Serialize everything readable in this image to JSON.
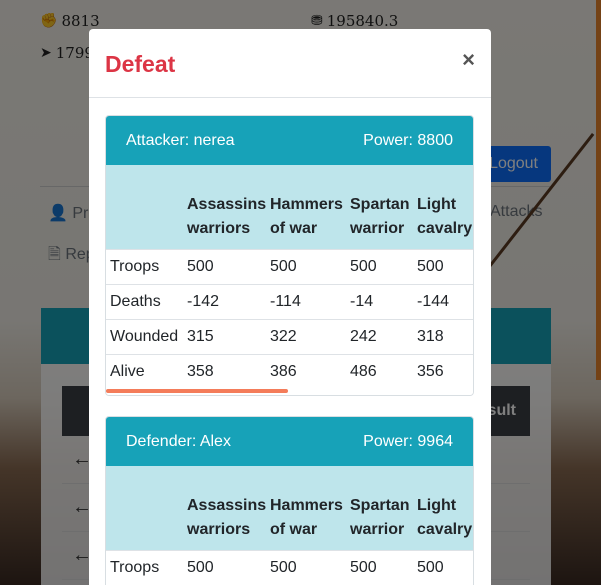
{
  "background": {
    "stats": [
      {
        "icon": "fist-icon",
        "glyph": "✊",
        "value": "8813"
      },
      {
        "icon": "coins-icon",
        "glyph": "⛃",
        "value": "195840.3"
      },
      {
        "icon": "fish-icon",
        "glyph": "➤",
        "value": "1799"
      }
    ],
    "logout_label": "Logout",
    "nav": {
      "profile_label": "Pro",
      "attacks_label": "Attacks",
      "reports_label": "Rep"
    },
    "result_label": "sult"
  },
  "modal": {
    "title": "Defeat",
    "close_glyph": "×",
    "cards": [
      {
        "role_label": "Attacker: nerea",
        "power_label": "Power: 8800",
        "columns": [
          "",
          "Assassins warriors",
          "Hammers of war",
          "Spartan warrior",
          "Light cavalry"
        ],
        "rows": [
          [
            "Troops",
            "500",
            "500",
            "500",
            "500"
          ],
          [
            "Deaths",
            "-142",
            "-114",
            "-14",
            "-144"
          ],
          [
            "Wounded",
            "315",
            "322",
            "242",
            "318"
          ],
          [
            "Alive",
            "358",
            "386",
            "486",
            "356"
          ]
        ]
      },
      {
        "role_label": "Defender: Alex",
        "power_label": "Power: 9964",
        "columns": [
          "",
          "Assassins warriors",
          "Hammers of war",
          "Spartan warrior",
          "Light cavalry"
        ],
        "rows": [
          [
            "Troops",
            "500",
            "500",
            "500",
            "500"
          ]
        ]
      }
    ]
  },
  "colors": {
    "danger": "#dc3545",
    "info": "#17a2b8",
    "info_light": "#bee5eb",
    "primary": "#0d6efd"
  }
}
